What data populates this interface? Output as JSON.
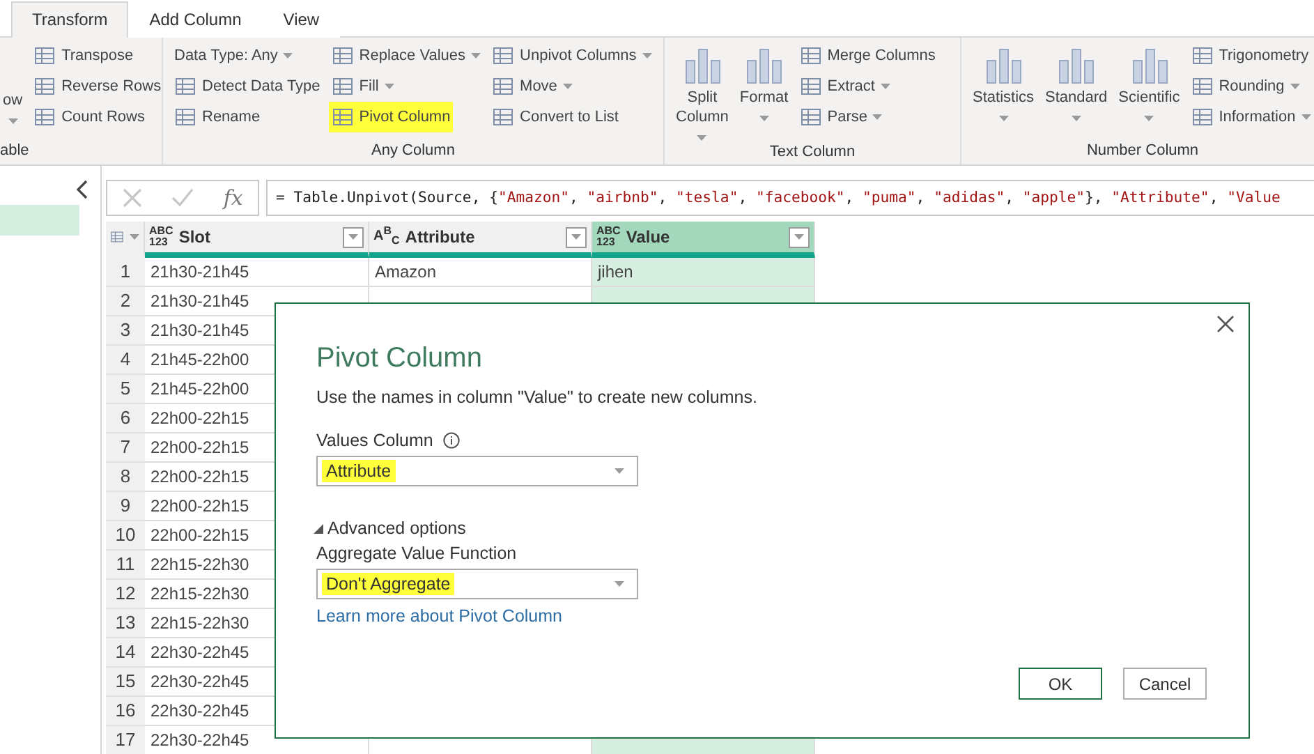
{
  "ribbon": {
    "tabs": [
      {
        "label": "Transform",
        "selected": true
      },
      {
        "label": "Add Column",
        "selected": false
      },
      {
        "label": "View",
        "selected": false
      }
    ],
    "groups": [
      {
        "label": "able",
        "columns": [
          {
            "kind": "large",
            "items": [
              {
                "label": "ow",
                "icon": false,
                "dropdown": true,
                "highlighted": false
              }
            ]
          },
          {
            "kind": "small",
            "items": [
              {
                "label": "Transpose",
                "icon": true,
                "dropdown": false,
                "highlighted": false
              },
              {
                "label": "Reverse Rows",
                "icon": true,
                "dropdown": false,
                "highlighted": false
              },
              {
                "label": "Count Rows",
                "icon": true,
                "dropdown": false,
                "highlighted": false
              }
            ]
          }
        ]
      },
      {
        "label": "Any Column",
        "columns": [
          {
            "kind": "small",
            "items": [
              {
                "label": "Data Type: Any",
                "icon": false,
                "dropdown": true,
                "highlighted": false
              },
              {
                "label": "Detect Data Type",
                "icon": true,
                "dropdown": false,
                "highlighted": false
              },
              {
                "label": "Rename",
                "icon": true,
                "dropdown": false,
                "highlighted": false
              }
            ]
          },
          {
            "kind": "small",
            "items": [
              {
                "label": "Replace Values",
                "icon": true,
                "dropdown": true,
                "highlighted": false
              },
              {
                "label": "Fill",
                "icon": true,
                "dropdown": true,
                "highlighted": false
              },
              {
                "label": "Pivot Column",
                "icon": true,
                "dropdown": false,
                "highlighted": true
              }
            ]
          },
          {
            "kind": "small",
            "items": [
              {
                "label": "Unpivot Columns",
                "icon": true,
                "dropdown": true,
                "highlighted": false
              },
              {
                "label": "Move",
                "icon": true,
                "dropdown": true,
                "highlighted": false
              },
              {
                "label": "Convert to List",
                "icon": true,
                "dropdown": false,
                "highlighted": false
              }
            ]
          }
        ]
      },
      {
        "label": "Text Column",
        "columns": [
          {
            "kind": "large",
            "items": [
              {
                "label": "Split Column",
                "icon": true,
                "dropdown": true,
                "highlighted": false
              }
            ]
          },
          {
            "kind": "large",
            "items": [
              {
                "label": "Format",
                "icon": true,
                "dropdown": true,
                "highlighted": false
              }
            ]
          },
          {
            "kind": "small",
            "items": [
              {
                "label": "Merge Columns",
                "icon": true,
                "dropdown": false,
                "highlighted": false
              },
              {
                "label": "Extract",
                "icon": true,
                "dropdown": true,
                "highlighted": false
              },
              {
                "label": "Parse",
                "icon": true,
                "dropdown": true,
                "highlighted": false
              }
            ]
          }
        ]
      },
      {
        "label": "Number Column",
        "columns": [
          {
            "kind": "large",
            "items": [
              {
                "label": "Statistics",
                "icon": true,
                "dropdown": true,
                "highlighted": false
              }
            ]
          },
          {
            "kind": "large",
            "items": [
              {
                "label": "Standard",
                "icon": true,
                "dropdown": true,
                "highlighted": false
              }
            ]
          },
          {
            "kind": "large",
            "items": [
              {
                "label": "Scientific",
                "icon": true,
                "dropdown": true,
                "highlighted": false
              }
            ]
          },
          {
            "kind": "small",
            "items": [
              {
                "label": "Trigonometry",
                "icon": true,
                "dropdown": false,
                "highlighted": false
              },
              {
                "label": "Rounding",
                "icon": true,
                "dropdown": true,
                "highlighted": false
              },
              {
                "label": "Information",
                "icon": true,
                "dropdown": true,
                "highlighted": false
              }
            ]
          }
        ]
      }
    ]
  },
  "queries": [
    {
      "selected": true
    }
  ],
  "formula_bar": {
    "fx_label": "fx",
    "formula": "= Table.Unpivot(Source, {\"Amazon\", \"airbnb\", \"tesla\", \"facebook\", \"puma\", \"adidas\", \"apple\"}, \"Attribute\", \"Value"
  },
  "table": {
    "columns": [
      {
        "name": "Slot",
        "kind": "any",
        "type_glyphs": [
          "ABC",
          "123"
        ],
        "selected": false
      },
      {
        "name": "Attribute",
        "kind": "text",
        "type_glyphs": [
          "A",
          "B",
          "C"
        ],
        "selected": false
      },
      {
        "name": "Value",
        "kind": "any",
        "type_glyphs": [
          "ABC",
          "123"
        ],
        "selected": true
      }
    ],
    "rows": [
      {
        "num": "1",
        "cells": [
          "21h30-21h45",
          "Amazon",
          "jihen"
        ]
      },
      {
        "num": "2",
        "cells": [
          "21h30-21h45"
        ]
      },
      {
        "num": "3",
        "cells": [
          "21h30-21h45"
        ]
      },
      {
        "num": "4",
        "cells": [
          "21h45-22h00"
        ]
      },
      {
        "num": "5",
        "cells": [
          "21h45-22h00"
        ]
      },
      {
        "num": "6",
        "cells": [
          "22h00-22h15"
        ]
      },
      {
        "num": "7",
        "cells": [
          "22h00-22h15"
        ]
      },
      {
        "num": "8",
        "cells": [
          "22h00-22h15"
        ]
      },
      {
        "num": "9",
        "cells": [
          "22h00-22h15"
        ]
      },
      {
        "num": "10",
        "cells": [
          "22h00-22h15"
        ]
      },
      {
        "num": "11",
        "cells": [
          "22h15-22h30"
        ]
      },
      {
        "num": "12",
        "cells": [
          "22h15-22h30"
        ]
      },
      {
        "num": "13",
        "cells": [
          "22h15-22h30"
        ]
      },
      {
        "num": "14",
        "cells": [
          "22h30-22h45"
        ]
      },
      {
        "num": "15",
        "cells": [
          "22h30-22h45"
        ]
      },
      {
        "num": "16",
        "cells": [
          "22h30-22h45"
        ]
      },
      {
        "num": "17",
        "cells": [
          "22h30-22h45"
        ]
      }
    ]
  },
  "dialog": {
    "title": "Pivot Column",
    "description": "Use the names in column \"Value\" to create new columns.",
    "values_label": "Values Column",
    "values_dropdown": {
      "value": "Attribute",
      "highlighted": true
    },
    "advanced": {
      "label": "Advanced options",
      "expanded": true
    },
    "aggregate_label": "Aggregate Value Function",
    "aggregate_dropdown": {
      "value": "Don't Aggregate",
      "highlighted": true
    },
    "link": "Learn more about Pivot Column",
    "buttons": [
      {
        "label": "OK",
        "kind": "primary"
      },
      {
        "label": "Cancel",
        "kind": "secondary"
      }
    ]
  }
}
